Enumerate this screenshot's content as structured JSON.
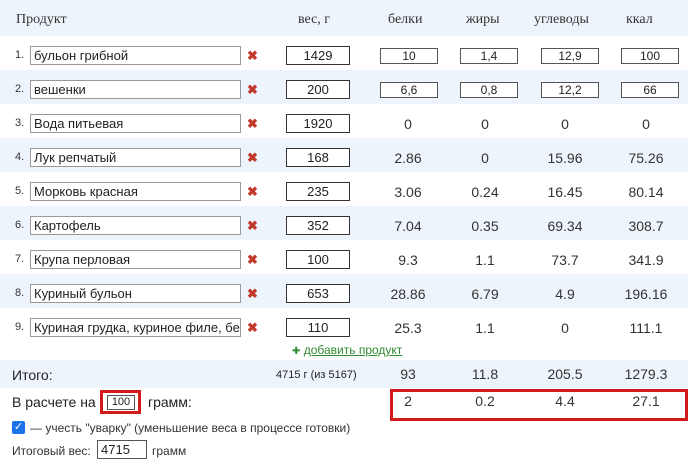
{
  "header": {
    "product": "Продукт",
    "weight": "вес, г",
    "protein": "белки",
    "fat": "жиры",
    "carbs": "углеводы",
    "kcal": "ккал"
  },
  "rows": [
    {
      "n": "1.",
      "name": "бульон грибной",
      "weight": "1429",
      "protein": "10",
      "fat": "1,4",
      "carbs": "12,9",
      "kcal": "100",
      "editable": true
    },
    {
      "n": "2.",
      "name": "вешенки",
      "weight": "200",
      "protein": "6,6",
      "fat": "0,8",
      "carbs": "12,2",
      "kcal": "66",
      "editable": true
    },
    {
      "n": "3.",
      "name": "Вода питьевая",
      "weight": "1920",
      "protein": "0",
      "fat": "0",
      "carbs": "0",
      "kcal": "0",
      "editable": false
    },
    {
      "n": "4.",
      "name": "Лук репчатый",
      "weight": "168",
      "protein": "2.86",
      "fat": "0",
      "carbs": "15.96",
      "kcal": "75.26",
      "editable": false
    },
    {
      "n": "5.",
      "name": "Морковь красная",
      "weight": "235",
      "protein": "3.06",
      "fat": "0.24",
      "carbs": "16.45",
      "kcal": "80.14",
      "editable": false
    },
    {
      "n": "6.",
      "name": "Картофель",
      "weight": "352",
      "protein": "7.04",
      "fat": "0.35",
      "carbs": "69.34",
      "kcal": "308.7",
      "editable": false
    },
    {
      "n": "7.",
      "name": "Крупа перловая",
      "weight": "100",
      "protein": "9.3",
      "fat": "1.1",
      "carbs": "73.7",
      "kcal": "341.9",
      "editable": false
    },
    {
      "n": "8.",
      "name": "Куриный бульон",
      "weight": "653",
      "protein": "28.86",
      "fat": "6.79",
      "carbs": "4.9",
      "kcal": "196.16",
      "editable": false
    },
    {
      "n": "9.",
      "name": "Куриная грудка, куриное филе, без",
      "weight": "110",
      "protein": "25.3",
      "fat": "1.1",
      "carbs": "0",
      "kcal": "111.1",
      "editable": false
    }
  ],
  "delete_glyph": "✖",
  "add_product": {
    "plus": "✚",
    "label": "добавить продукт"
  },
  "total": {
    "label": "Итого:",
    "weight": "4715 г (из 5167)",
    "protein": "93",
    "fat": "11.8",
    "carbs": "205.5",
    "kcal": "1279.3"
  },
  "per": {
    "label_before": "В расчете на",
    "amount": "100",
    "label_after": "грамм:",
    "protein": "2",
    "fat": "0.2",
    "carbs": "4.4",
    "kcal": "27.1"
  },
  "shrink": {
    "checked": true,
    "label": "— учесть \"уварку\" (уменьшение веса в процессе готовки)"
  },
  "final_weight": {
    "label": "Итоговый вес:",
    "value": "4715",
    "unit": "грамм"
  },
  "colors": {
    "accent": "#d21a1a",
    "band": "#eef4fb",
    "add_link": "#2f8a2f",
    "delete": "#c0392b",
    "check": "#1a73e8"
  }
}
